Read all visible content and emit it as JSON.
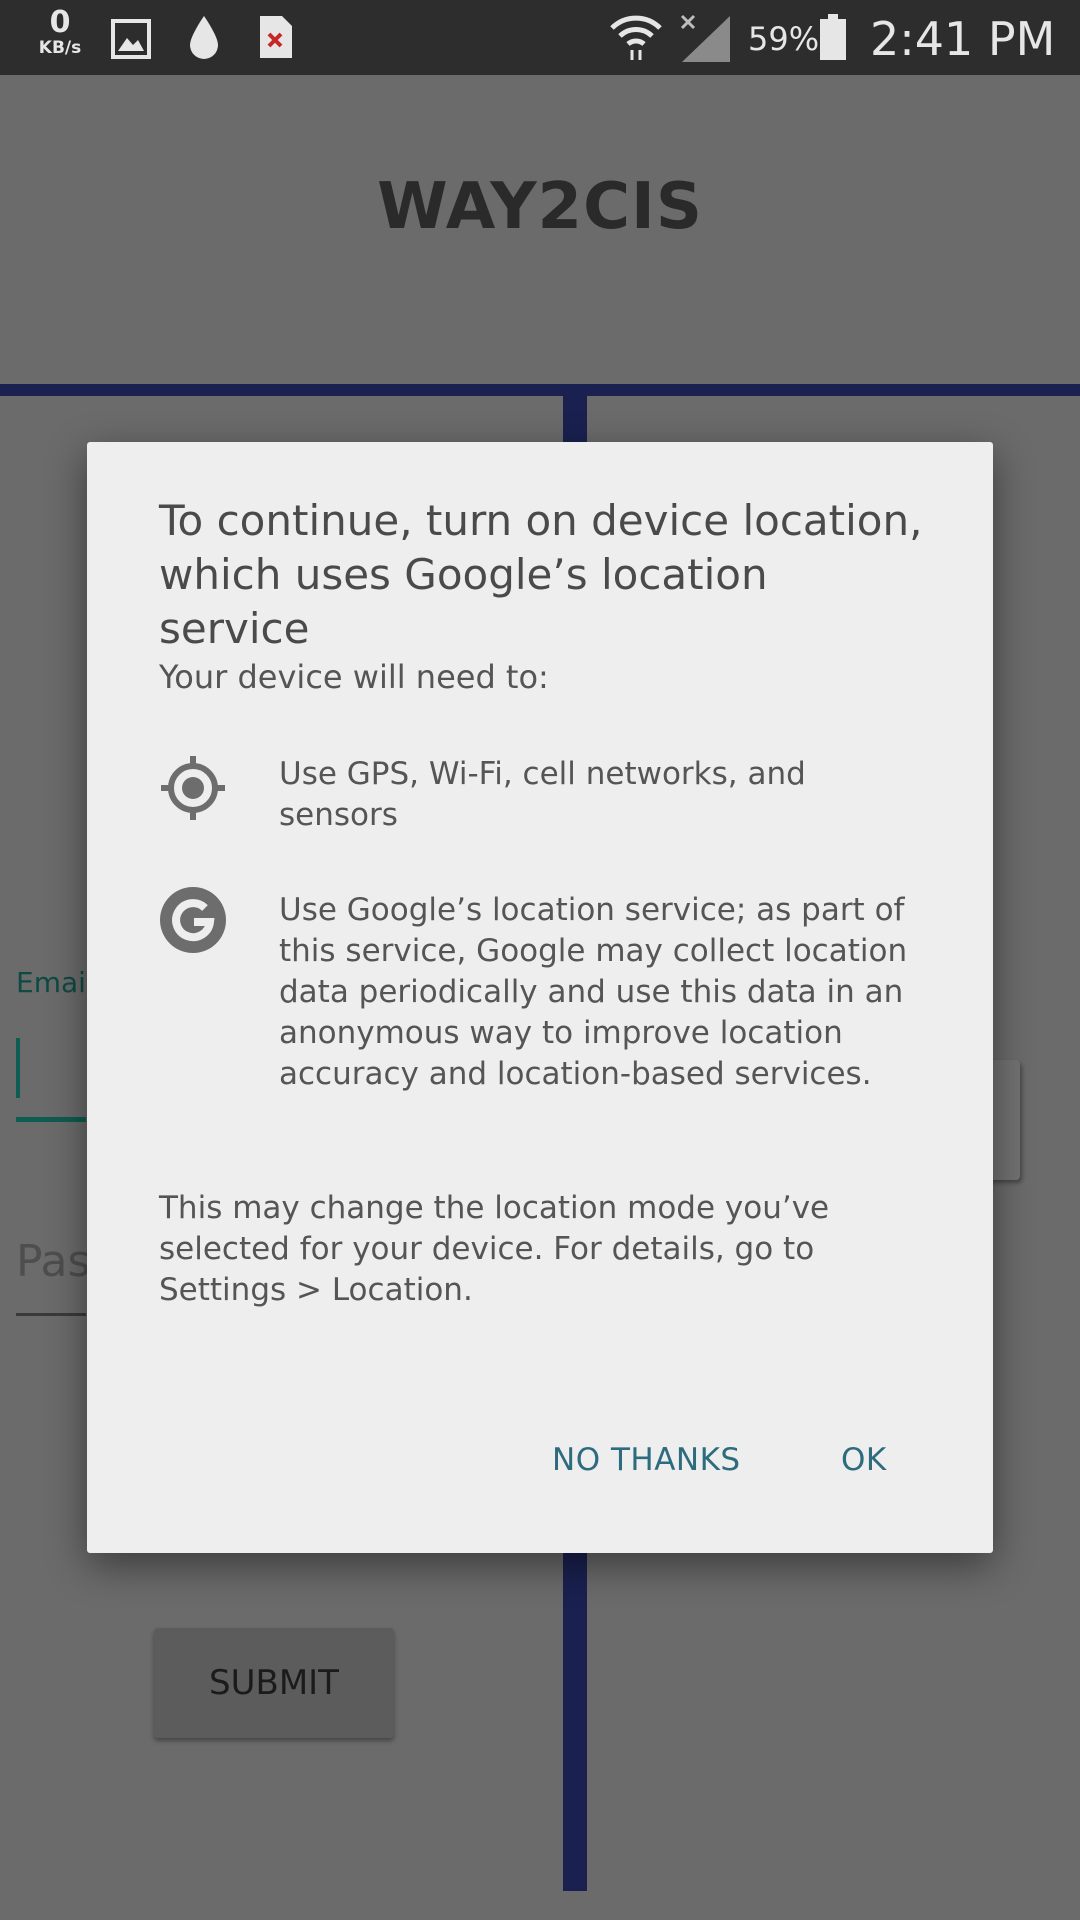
{
  "status_bar": {
    "speed_value": "0",
    "speed_unit": "KB/s",
    "battery": "59%",
    "time": "2:41 PM",
    "icons": [
      "image-icon",
      "drop-icon",
      "file-error-icon",
      "wifi-icon",
      "signal-icon",
      "battery-icon"
    ]
  },
  "app": {
    "title": "WAY2CIS",
    "email_label": "Email",
    "password_hint": "Pas",
    "submit_label": "SUBMIT",
    "accent_color": "#1a2150"
  },
  "dialog": {
    "title": "To continue, turn on device location, which uses Google’s location service",
    "subtitle": "Your device will need to:",
    "items": [
      {
        "icon": "gps-target-icon",
        "text": "Use GPS, Wi-Fi, cell networks, and sensors"
      },
      {
        "icon": "google-g-icon",
        "text": "Use Google’s location service; as part of this service, Google may collect location data periodically and use this data in an anonymous way to improve location accuracy and location-based services."
      }
    ],
    "note": "This may change the location mode you’ve selected for your device. For details, go to Settings > Location.",
    "buttons": {
      "no_thanks": "NO THANKS",
      "ok": "OK"
    },
    "button_color": "#2d6b7e"
  }
}
